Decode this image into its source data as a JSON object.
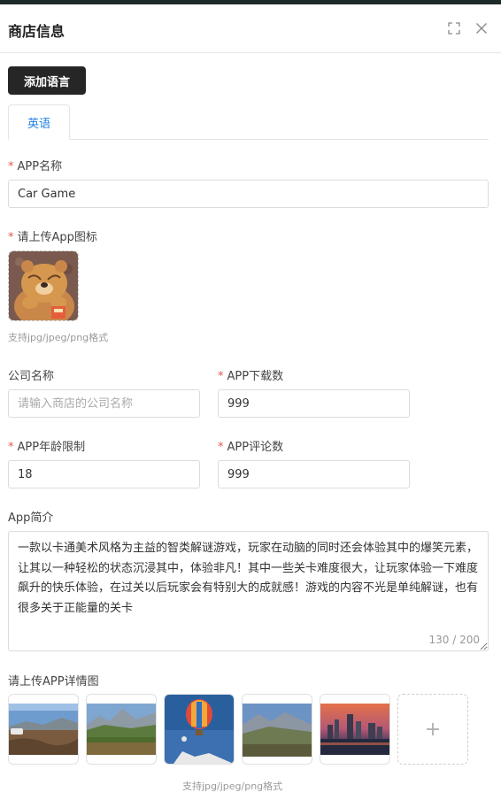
{
  "header": {
    "title": "商店信息",
    "fullscreen_icon": "fullscreen-icon",
    "close_icon": "close-icon"
  },
  "toolbar": {
    "add_language_label": "添加语言"
  },
  "tabs": [
    {
      "label": "英语",
      "active": true
    }
  ],
  "form": {
    "app_name": {
      "label": "APP名称",
      "required": true,
      "value": "Car Game"
    },
    "app_icon": {
      "label": "请上传App图标",
      "required": true,
      "hint": "支持jpg/jpeg/png格式"
    },
    "company_name": {
      "label": "公司名称",
      "required": false,
      "value": "",
      "placeholder": "请输入商店的公司名称"
    },
    "downloads": {
      "label": "APP下载数",
      "required": true,
      "value": "999"
    },
    "age_limit": {
      "label": "APP年龄限制",
      "required": true,
      "value": "18"
    },
    "reviews": {
      "label": "APP评论数",
      "required": true,
      "value": "999"
    },
    "intro": {
      "label": "App简介",
      "required": false,
      "value": "一款以卡通美术风格为主益的智类解谜游戏，玩家在动脑的同时还会体验其中的爆笑元素，让其以一种轻松的状态沉浸其中，体验非凡！其中一些关卡难度很大，让玩家体验一下难度飙升的快乐体验，在过关以后玩家会有特别大的成就感！游戏的内容不光是单纯解谜，也有很多关于正能量的关卡",
      "counter": "130 / 200"
    },
    "detail_images": {
      "label": "请上传APP详情图",
      "required": false,
      "hint": "支持jpg/jpeg/png格式",
      "add_icon": "plus-icon",
      "add_symbol": "+"
    }
  },
  "colors": {
    "accent": "#1e80e0",
    "required": "#e05a4f",
    "primary_button": "#262626"
  }
}
